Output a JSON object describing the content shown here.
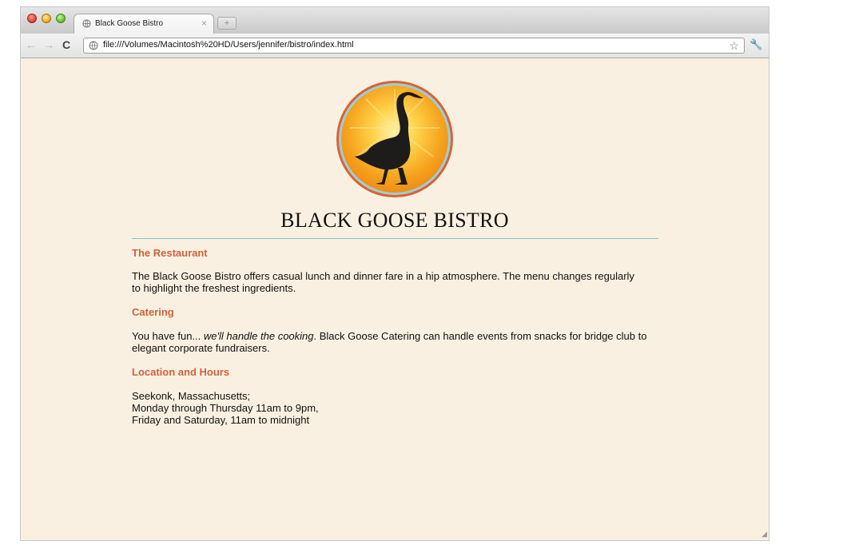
{
  "browser": {
    "tab_title": "Black Goose Bistro",
    "tab_close": "×",
    "new_tab": "+",
    "url": "file:///Volumes/Macintosh%20HD/Users/jennifer/bistro/index.html",
    "back": "←",
    "forward": "→",
    "reload": "C",
    "bookmark": "☆",
    "wrench": "🔧",
    "icons": {
      "favicon": "globe-icon",
      "page": "page-icon",
      "bookmark": "star-icon",
      "settings": "wrench-icon"
    }
  },
  "page": {
    "title": "BLACK GOOSE BISTRO",
    "sections": [
      {
        "heading": "The Restaurant",
        "text": "The Black Goose Bistro offers casual lunch and dinner fare in a hip atmosphere. The menu changes regularly to highlight the freshest ingredients."
      },
      {
        "heading": "Catering",
        "text_start": "You have fun... ",
        "text_em": "we'll handle the cooking",
        "text_end": ". Black Goose Catering can handle events from snacks for bridge club to elegant corporate fundraisers."
      },
      {
        "heading": "Location and Hours",
        "lines": [
          "Seekonk, Massachusetts;",
          "Monday through Thursday 11am to 9pm,",
          "Friday and Saturday, 11am to midnight"
        ]
      }
    ],
    "colors": {
      "background": "#faf0e1",
      "heading": "#d3613b",
      "rule": "#7ec3cf",
      "logo_orange": "#f39a1b"
    }
  }
}
